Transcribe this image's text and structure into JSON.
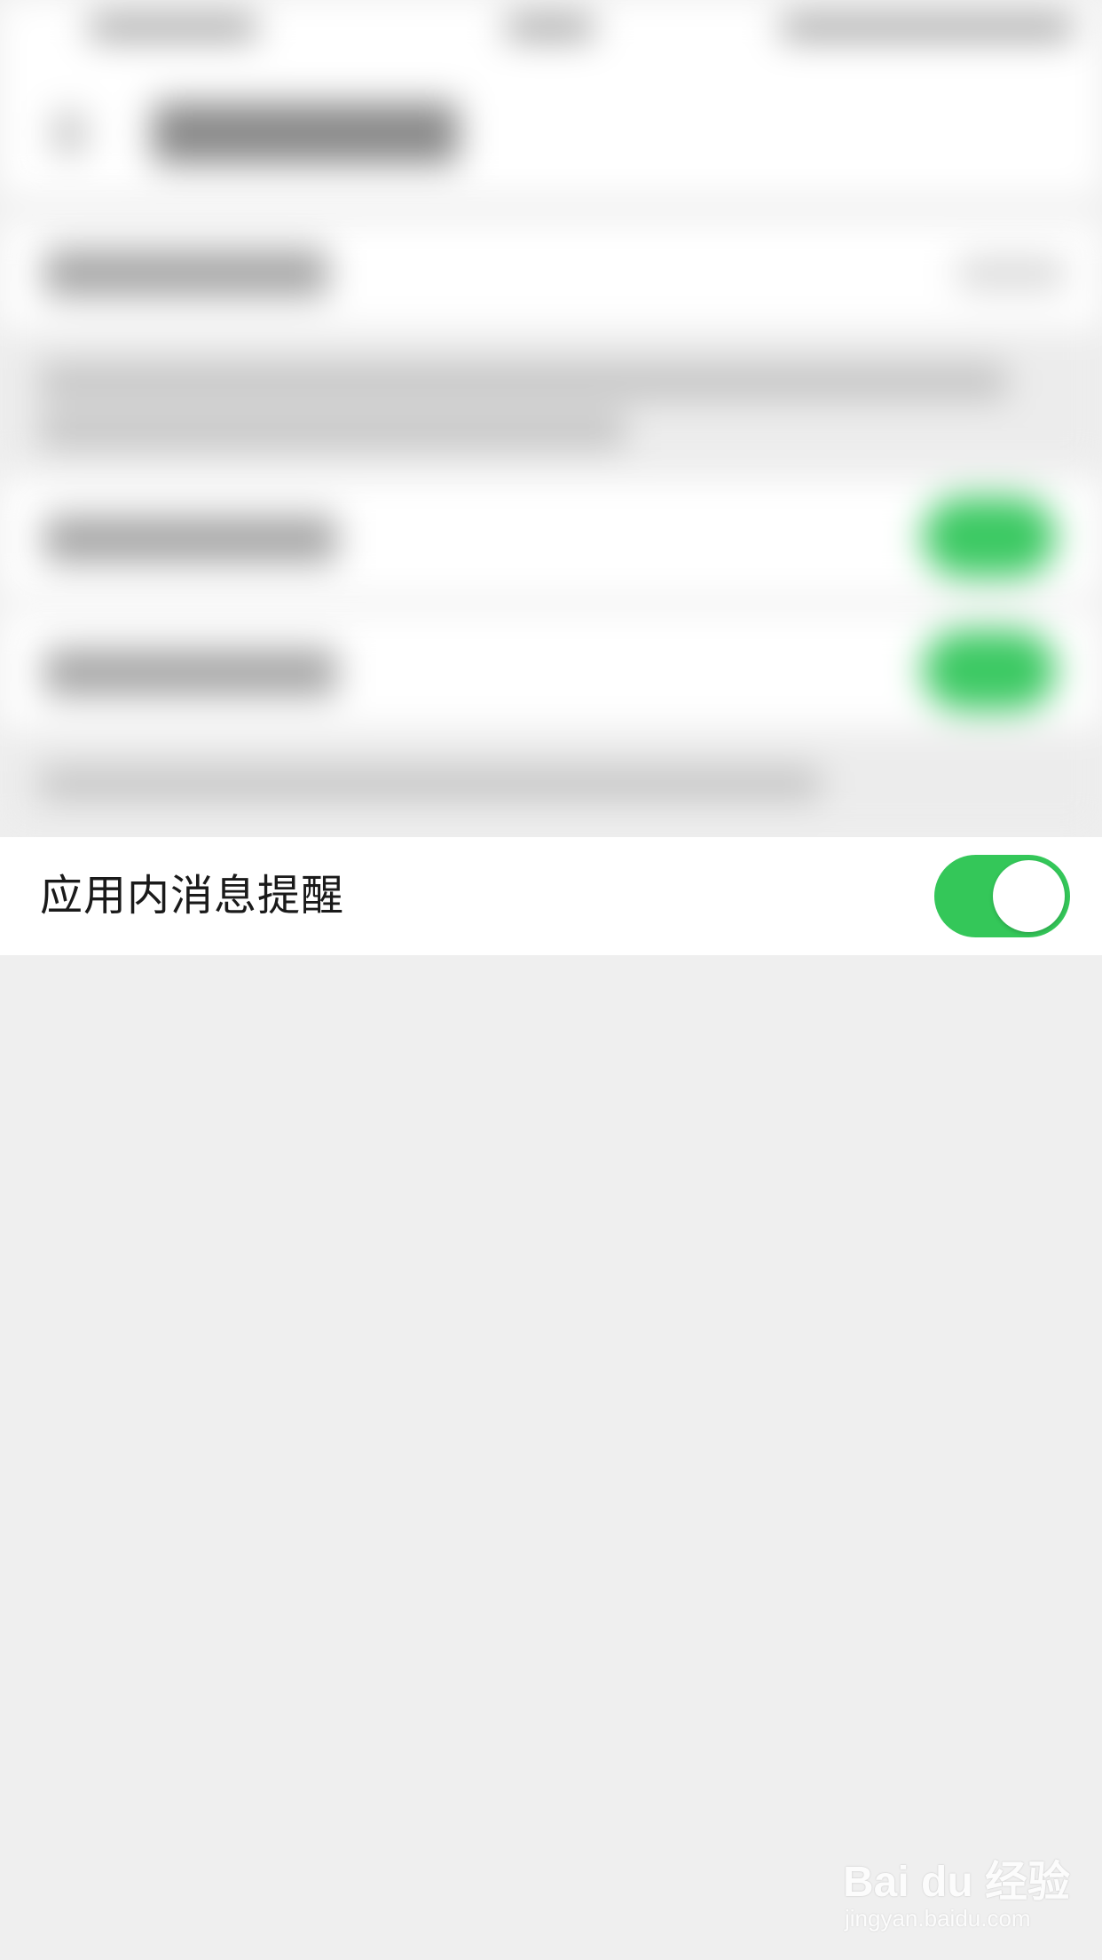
{
  "setting": {
    "label": "应用内消息提醒",
    "enabled": true
  },
  "colors": {
    "background": "#efefef",
    "row_background": "#ffffff",
    "toggle_on": "#34c759",
    "label_text": "#1a1a1a"
  },
  "watermark": {
    "logo_text": "Bai du 经验",
    "url_text": "jingyan.baidu.com"
  }
}
